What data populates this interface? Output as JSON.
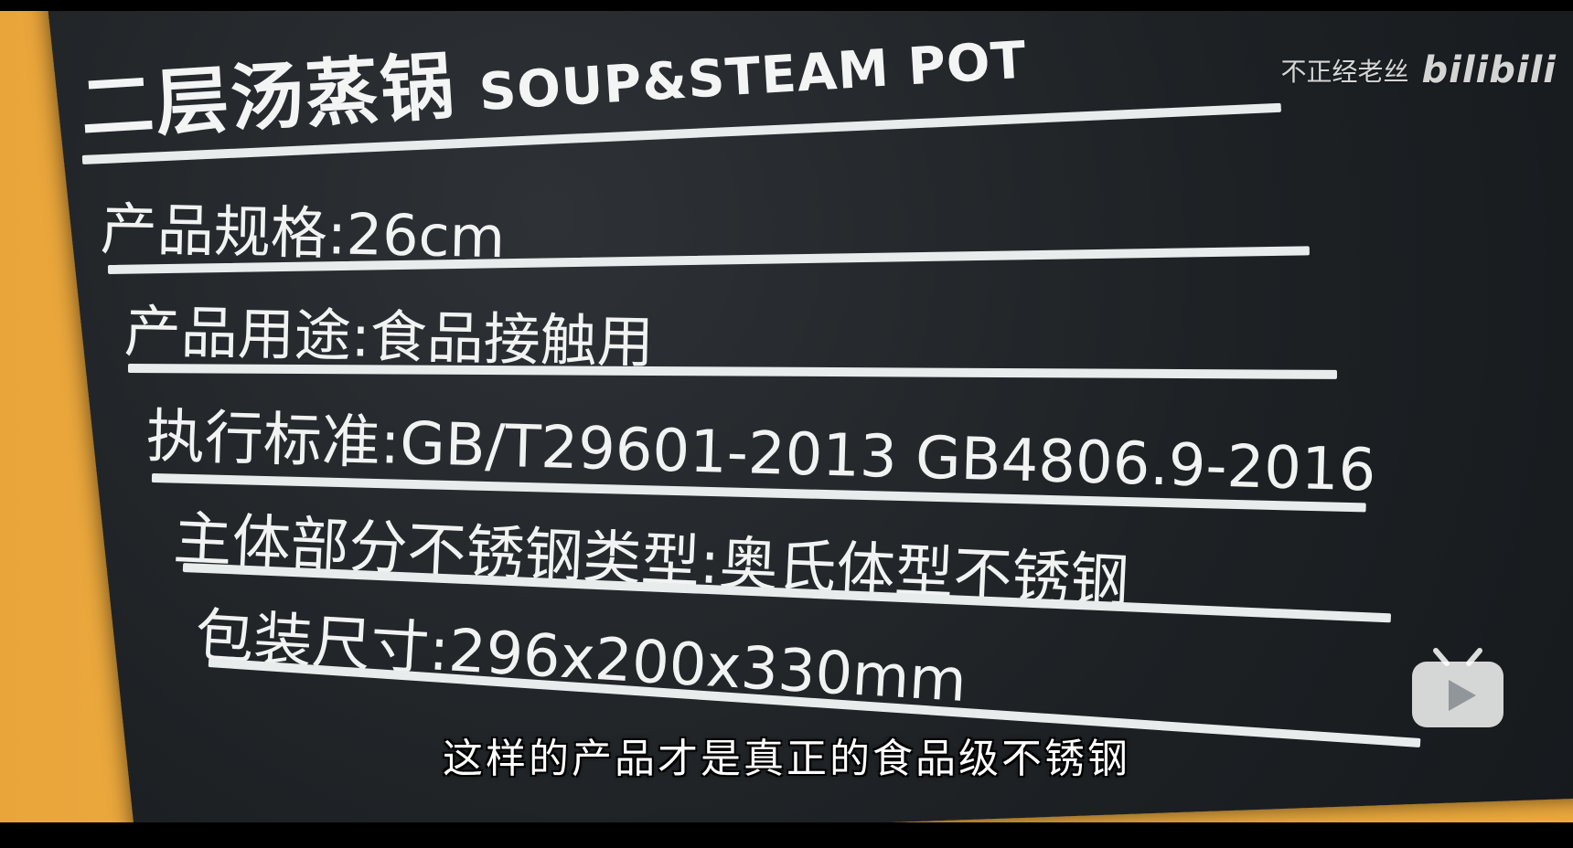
{
  "label": {
    "title_zh": "二层汤蒸锅",
    "title_en": "SOUP&STEAM POT",
    "specs": [
      {
        "key": "产品规格:",
        "value": "26cm"
      },
      {
        "key": "产品用途:",
        "value": "食品接触用"
      },
      {
        "key": "执行标准:",
        "value": "GB/T29601-2013  GB4806.9-2016"
      },
      {
        "key": "主体部分不锈钢类型:",
        "value": "奥氏体型不锈钢"
      },
      {
        "key": "包装尺寸:",
        "value": "296x200x330mm"
      }
    ]
  },
  "watermark": {
    "author": "不正经老丝",
    "logo": "bilibili",
    "icon": "bilibili-tv-play-icon"
  },
  "subtitle": {
    "text": "这样的产品才是真正的食品级不锈钢"
  },
  "colors": {
    "background_orange": "#eeaa3c",
    "plate_dark": "#1d2124",
    "label_text": "#f1f3f3",
    "letterbox": "#000000"
  }
}
